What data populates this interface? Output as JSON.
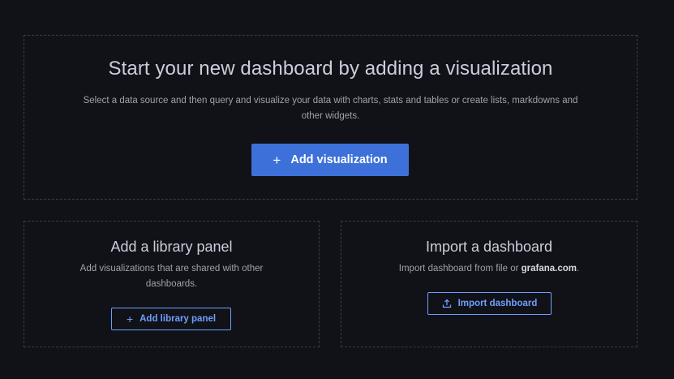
{
  "main": {
    "title": "Start your new dashboard by adding a visualization",
    "description": "Select a data source and then query and visualize your data with charts, stats and tables or create lists, markdowns and other widgets.",
    "add_visualization_label": "Add visualization",
    "add_icon": "plus-icon"
  },
  "library": {
    "title": "Add a library panel",
    "description": "Add visualizations that are shared with other dashboards.",
    "button_label": "Add library panel",
    "button_icon": "plus-icon"
  },
  "import": {
    "title": "Import a dashboard",
    "description_prefix": "Import dashboard from file or ",
    "description_link": "grafana.com",
    "description_suffix": ".",
    "button_label": "Import dashboard",
    "button_icon": "upload-icon"
  },
  "colors": {
    "background": "#111217",
    "primary": "#3d71d9",
    "link": "#6e9fff"
  }
}
